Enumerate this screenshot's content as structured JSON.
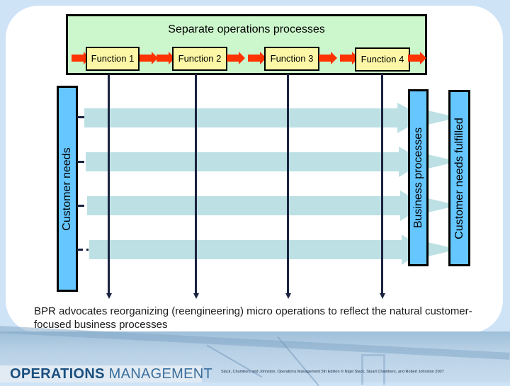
{
  "diagram": {
    "title": "Separate operations processes",
    "functions": [
      "Function 1",
      "Function 2",
      "Function 3",
      "Function 4"
    ],
    "left_bar_label": "Customer needs",
    "middle_bar_label": "Business processes",
    "right_bar_label": "Customer needs fulfilled",
    "process_lane_count": 4,
    "colors": {
      "function_strip": "#ccf7cc",
      "function_box": "#fcf7a6",
      "flow_arrow": "#ff3300",
      "side_bar": "#66c6ff",
      "process_lane": "#bce0e3",
      "vertical_line": "#1a2340"
    }
  },
  "caption": "BPR advocates reorganizing (reengineering) micro operations to reflect the natural customer-focused business processes",
  "footer": {
    "brand_bold": "OPERATIONS",
    "brand_light": "MANAGEMENT",
    "copyright": "Slack, Chambers and Johnston, Operations Management 5th Edition © Nigel Slack, Stuart Chambers, and Robert Johnston 2007"
  }
}
